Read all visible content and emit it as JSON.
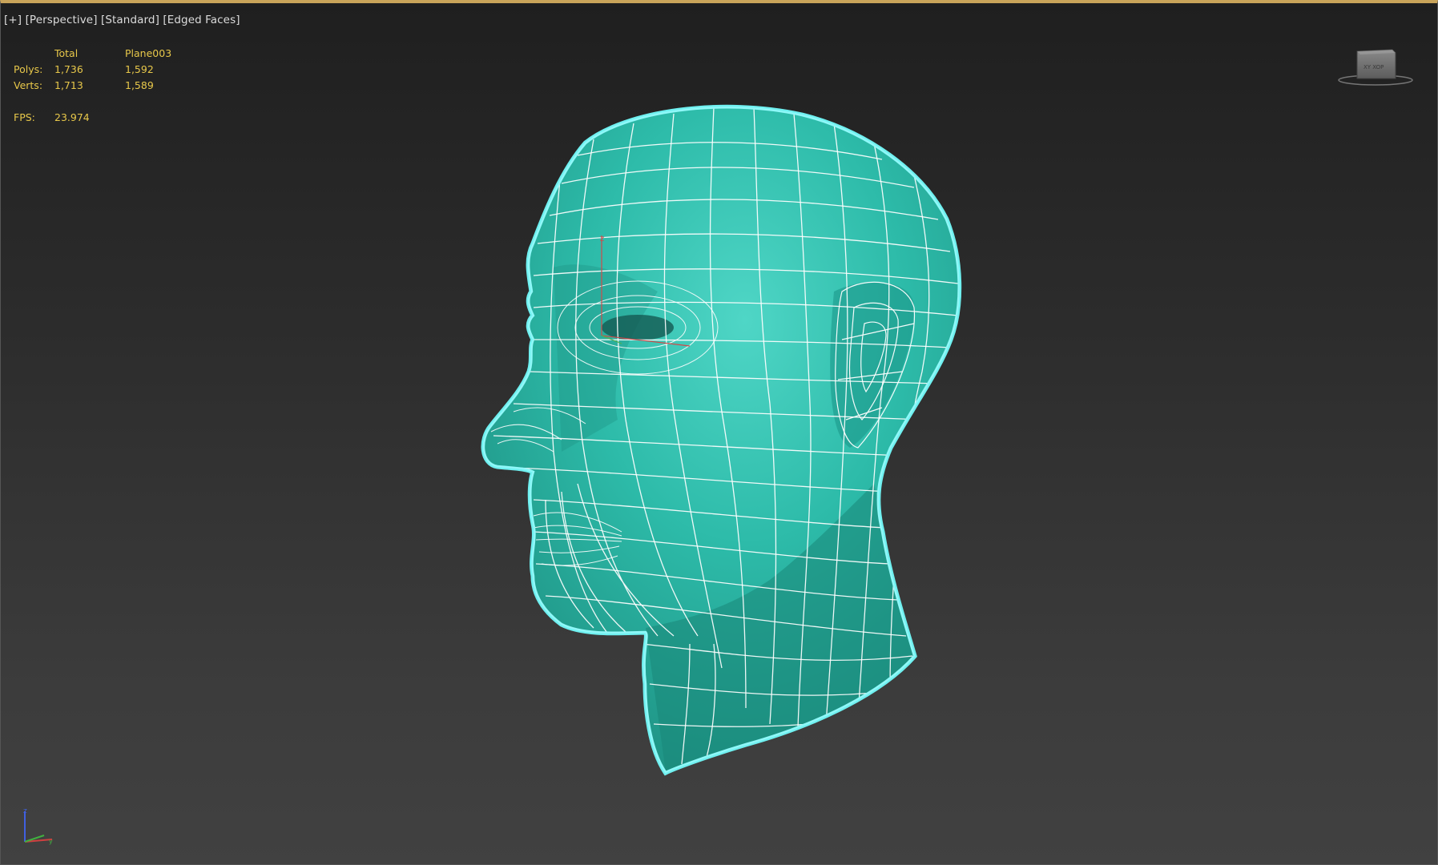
{
  "viewport": {
    "label_parts": [
      "[+]",
      "[Perspective]",
      "[Standard]",
      "[Edged Faces]"
    ]
  },
  "stats": {
    "header_total": "Total",
    "header_object": "Plane003",
    "polys_label": "Polys:",
    "polys_total": "1,736",
    "polys_object": "1,592",
    "verts_label": "Verts:",
    "verts_total": "1,713",
    "verts_object": "1,589",
    "fps_label": "FPS:",
    "fps_value": "23.974"
  },
  "viewcube": {
    "icon": "viewcube-icon"
  },
  "model": {
    "name": "head-mesh",
    "fill_color": "#2bb8a8",
    "outline_color": "#6ff0f0",
    "wire_color": "#ffffff"
  },
  "axis_tripod": {
    "icon": "axis-tripod-icon",
    "colors": {
      "x": "#d04040",
      "y": "#40b040",
      "z": "#4060e0"
    }
  },
  "colors": {
    "active_border": "#c9a45a",
    "stats_text": "#e8c84a",
    "label_text": "#dcdcdc"
  }
}
